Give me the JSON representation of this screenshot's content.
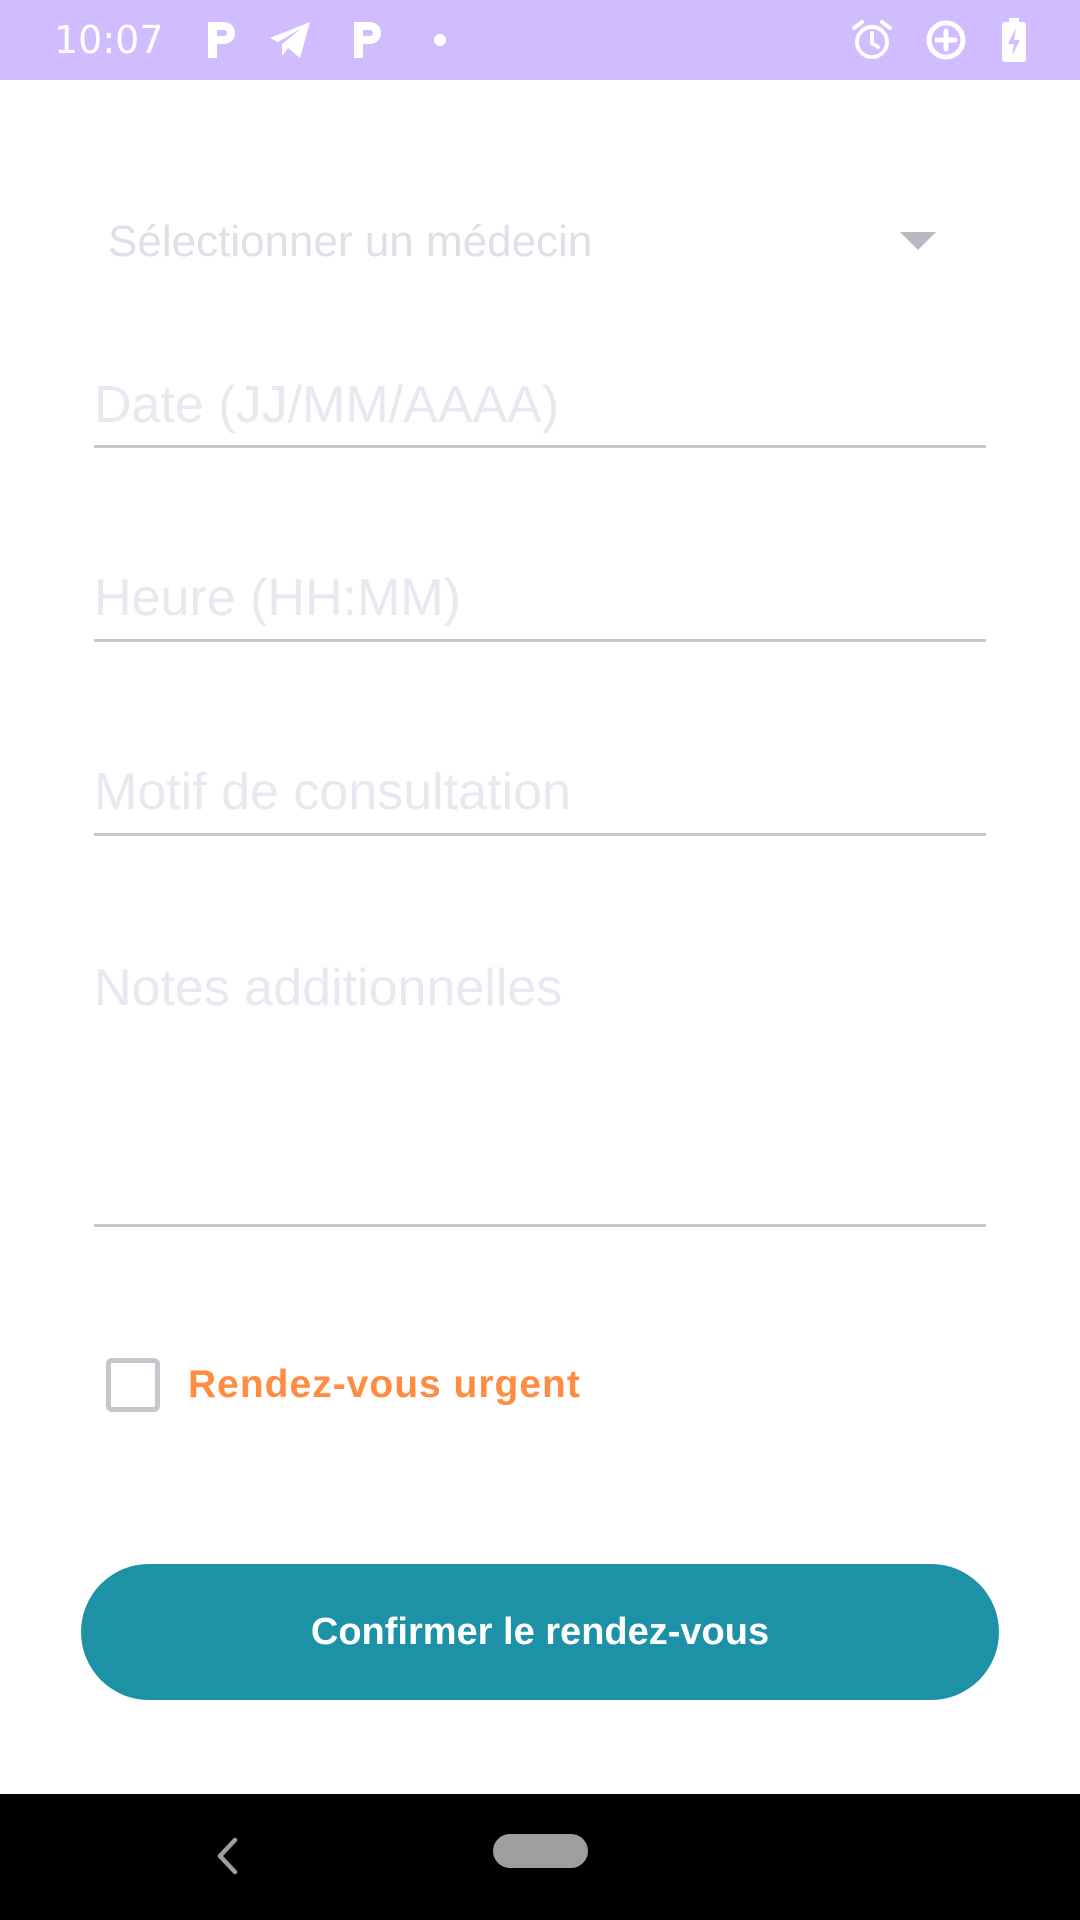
{
  "status_bar": {
    "time": "10:07",
    "left_icons": [
      "parking-app-icon",
      "telegram-icon",
      "parking-app-icon",
      "notification-dot-icon"
    ],
    "right_icons": [
      "alarm-icon",
      "data-saver-icon",
      "battery-charging-icon"
    ],
    "background_color": "#d0bcff"
  },
  "form": {
    "doctor_spinner": {
      "label": "Sélectionner un médecin"
    },
    "date_field": {
      "placeholder": "Date (JJ/MM/AAAA)",
      "value": ""
    },
    "time_field": {
      "placeholder": "Heure (HH:MM)",
      "value": ""
    },
    "reason_field": {
      "placeholder": "Motif de consultation",
      "value": ""
    },
    "notes_field": {
      "placeholder": "Notes additionnelles",
      "value": ""
    },
    "urgent_checkbox": {
      "label": "Rendez-vous urgent",
      "checked": false,
      "label_color": "#ff8c42"
    },
    "confirm_button": {
      "label": "Confirmer le rendez-vous",
      "color": "#1d91a5"
    }
  },
  "nav_bar": {
    "icons": [
      "back-icon",
      "home-pill-icon"
    ]
  }
}
